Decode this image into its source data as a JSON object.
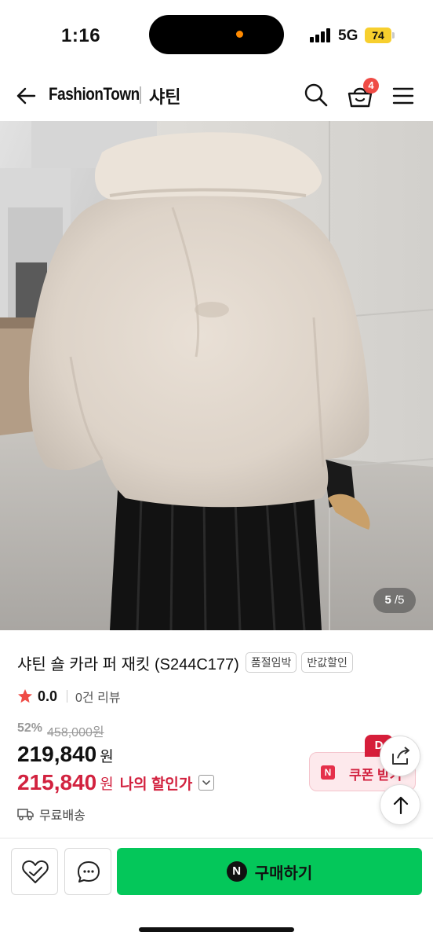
{
  "status_bar": {
    "time": "1:16",
    "network": "5G",
    "battery": "74"
  },
  "header": {
    "brand": "FashionTown",
    "store": "샤틴",
    "cart_count": "4",
    "icons": [
      "back-arrow-icon",
      "search-icon",
      "cart-icon",
      "menu-icon"
    ]
  },
  "gallery": {
    "current": "5",
    "separator": "/",
    "total": "5"
  },
  "product": {
    "title": "샤틴 숄 카라 퍼 재킷  (S244C177)",
    "tags": [
      "품절임박",
      "반값할인"
    ],
    "rating": "0.0",
    "review_count": "0건 리뷰",
    "discount_rate": "52%",
    "original_price": "458,000원",
    "sale_price": "219,840",
    "currency": "원",
    "my_price": "215,840",
    "my_discount_label": "나의 할인가",
    "shipping": "무료배송"
  },
  "coupon": {
    "badge": "D",
    "n_mark": "N",
    "label": "쿠폰 받기"
  },
  "bottom_bar": {
    "buy_n_mark": "N",
    "buy_label": "구매하기"
  },
  "colors": {
    "brand_green": "#04c75a",
    "discount_red": "#d2223f",
    "cart_badge": "#ef4b45",
    "battery": "#f7cf2e",
    "star": "#ef4b45"
  }
}
